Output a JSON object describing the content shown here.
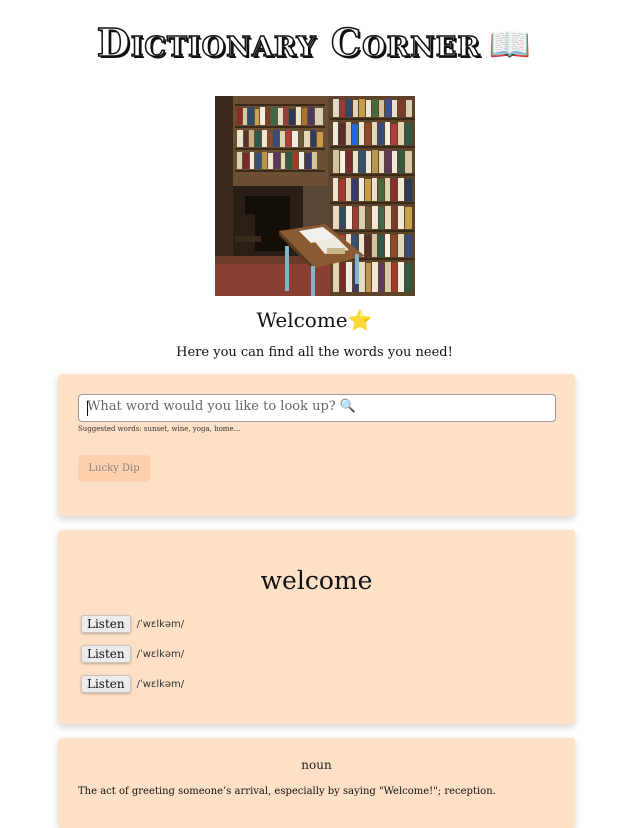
{
  "header": {
    "title": "Dictionary Corner",
    "emoji": "📖"
  },
  "hero": {
    "alt": "Bookshelves in a library room"
  },
  "welcome": {
    "text": "Welcome",
    "emoji": "⭐"
  },
  "tagline": "Here you can find all the words you need!",
  "search": {
    "placeholder": "What word would you like to look up? 🔍",
    "suggestions": "Suggested words: sunset, wine, yoga, home...",
    "lucky_label": "Lucky Dip"
  },
  "word": {
    "title": "welcome",
    "phonetics": [
      {
        "button": "Listen",
        "ipa": "/ˈwɛlkəm/"
      },
      {
        "button": "Listen",
        "ipa": "/ˈwɛlkəm/"
      },
      {
        "button": "Listen",
        "ipa": "/ˈwɛlkəm/"
      }
    ]
  },
  "meaning": {
    "part_of_speech": "noun",
    "definition": "The act of greeting someone’s arrival, especially by saying \"Welcome!\"; reception."
  },
  "colors": {
    "card_bg": "#fde0c6",
    "button_bg": "#fdd0ae",
    "star": "#f6c445"
  }
}
